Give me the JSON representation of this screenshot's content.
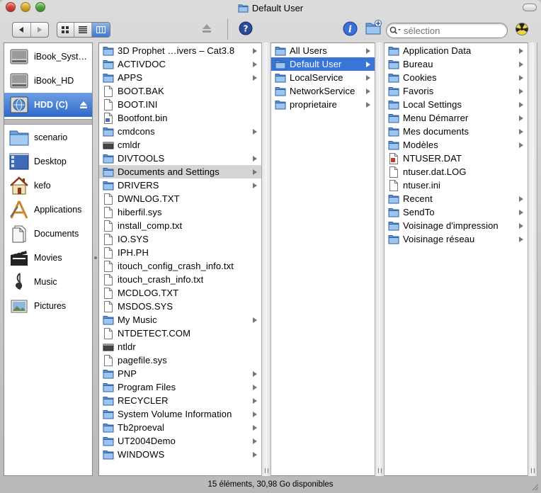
{
  "window": {
    "title": "Default User",
    "status": "15 éléments, 30,98 Go disponibles"
  },
  "colors": {
    "selection_blue": "#3875d7",
    "folder_blue": "#6ea6e0",
    "sidebar_selected": "#3a74d0"
  },
  "toolbar": {
    "search_placeholder": "sélection",
    "icons": [
      "back-arrow-icon",
      "forward-arrow-icon",
      "icon-view-icon",
      "list-view-icon",
      "column-view-icon",
      "eject-icon",
      "help-icon",
      "info-icon",
      "new-folder-icon",
      "burn-icon",
      "search-icon"
    ]
  },
  "sidebar": {
    "devices": [
      {
        "label": "iBook_Syst…",
        "icon": "hard-drive-icon"
      },
      {
        "label": "iBook_HD",
        "icon": "hard-drive-icon"
      },
      {
        "label": "HDD (C)",
        "icon": "network-drive-icon",
        "selected": true
      }
    ],
    "places": [
      {
        "label": "scenario",
        "icon": "folder-icon"
      },
      {
        "label": "Desktop",
        "icon": "desktop-icon"
      },
      {
        "label": "kefo",
        "icon": "home-icon"
      },
      {
        "label": "Applications",
        "icon": "applications-icon"
      },
      {
        "label": "Documents",
        "icon": "documents-icon"
      },
      {
        "label": "Movies",
        "icon": "movies-icon"
      },
      {
        "label": "Music",
        "icon": "music-icon"
      },
      {
        "label": "Pictures",
        "icon": "pictures-icon"
      }
    ]
  },
  "columns": [
    {
      "items": [
        {
          "name": "3D Prophet …ivers – Cat3.8",
          "type": "folder",
          "arrow": true
        },
        {
          "name": "ACTIVDOC",
          "type": "folder",
          "arrow": true
        },
        {
          "name": "APPS",
          "type": "folder",
          "arrow": true
        },
        {
          "name": "BOOT.BAK",
          "type": "doc"
        },
        {
          "name": "BOOT.INI",
          "type": "doc"
        },
        {
          "name": "Bootfont.bin",
          "type": "app-doc"
        },
        {
          "name": "cmdcons",
          "type": "folder",
          "arrow": true
        },
        {
          "name": "cmldr",
          "type": "exe"
        },
        {
          "name": "DIVTOOLS",
          "type": "folder",
          "arrow": true
        },
        {
          "name": "Documents and Settings",
          "type": "folder",
          "arrow": true,
          "selected": "gray"
        },
        {
          "name": "DRIVERS",
          "type": "folder",
          "arrow": true
        },
        {
          "name": "DWNLOG.TXT",
          "type": "doc"
        },
        {
          "name": "hiberfil.sys",
          "type": "doc"
        },
        {
          "name": "install_comp.txt",
          "type": "doc"
        },
        {
          "name": "IO.SYS",
          "type": "doc"
        },
        {
          "name": "IPH.PH",
          "type": "doc"
        },
        {
          "name": "itouch_config_crash_info.txt",
          "type": "doc"
        },
        {
          "name": "itouch_crash_info.txt",
          "type": "doc"
        },
        {
          "name": "MCDLOG.TXT",
          "type": "doc"
        },
        {
          "name": "MSDOS.SYS",
          "type": "doc"
        },
        {
          "name": "My Music",
          "type": "folder",
          "arrow": true
        },
        {
          "name": "NTDETECT.COM",
          "type": "doc"
        },
        {
          "name": "ntldr",
          "type": "exe"
        },
        {
          "name": "pagefile.sys",
          "type": "doc"
        },
        {
          "name": "PNP",
          "type": "folder",
          "arrow": true
        },
        {
          "name": "Program Files",
          "type": "folder",
          "arrow": true
        },
        {
          "name": "RECYCLER",
          "type": "folder",
          "arrow": true
        },
        {
          "name": "System Volume Information",
          "type": "folder",
          "arrow": true
        },
        {
          "name": "Tb2proeval",
          "type": "folder",
          "arrow": true
        },
        {
          "name": "UT2004Demo",
          "type": "folder",
          "arrow": true
        },
        {
          "name": "WINDOWS",
          "type": "folder",
          "arrow": true
        }
      ]
    },
    {
      "items": [
        {
          "name": "All Users",
          "type": "folder",
          "arrow": true
        },
        {
          "name": "Default User",
          "type": "folder",
          "arrow": true,
          "selected": "blue"
        },
        {
          "name": "LocalService",
          "type": "folder",
          "arrow": true
        },
        {
          "name": "NetworkService",
          "type": "folder",
          "arrow": true
        },
        {
          "name": "proprietaire",
          "type": "folder",
          "arrow": true
        }
      ]
    },
    {
      "items": [
        {
          "name": "Application Data",
          "type": "folder",
          "arrow": true
        },
        {
          "name": "Bureau",
          "type": "folder",
          "arrow": true
        },
        {
          "name": "Cookies",
          "type": "folder",
          "arrow": true
        },
        {
          "name": "Favoris",
          "type": "folder",
          "arrow": true
        },
        {
          "name": "Local Settings",
          "type": "folder",
          "arrow": true
        },
        {
          "name": "Menu Démarrer",
          "type": "folder",
          "arrow": true
        },
        {
          "name": "Mes documents",
          "type": "folder",
          "arrow": true
        },
        {
          "name": "Modèles",
          "type": "folder",
          "arrow": true
        },
        {
          "name": "NTUSER.DAT",
          "type": "dat-doc"
        },
        {
          "name": "ntuser.dat.LOG",
          "type": "doc"
        },
        {
          "name": "ntuser.ini",
          "type": "doc"
        },
        {
          "name": "Recent",
          "type": "folder",
          "arrow": true
        },
        {
          "name": "SendTo",
          "type": "folder",
          "arrow": true
        },
        {
          "name": "Voisinage d'impression",
          "type": "folder",
          "arrow": true
        },
        {
          "name": "Voisinage réseau",
          "type": "folder",
          "arrow": true
        }
      ]
    }
  ]
}
